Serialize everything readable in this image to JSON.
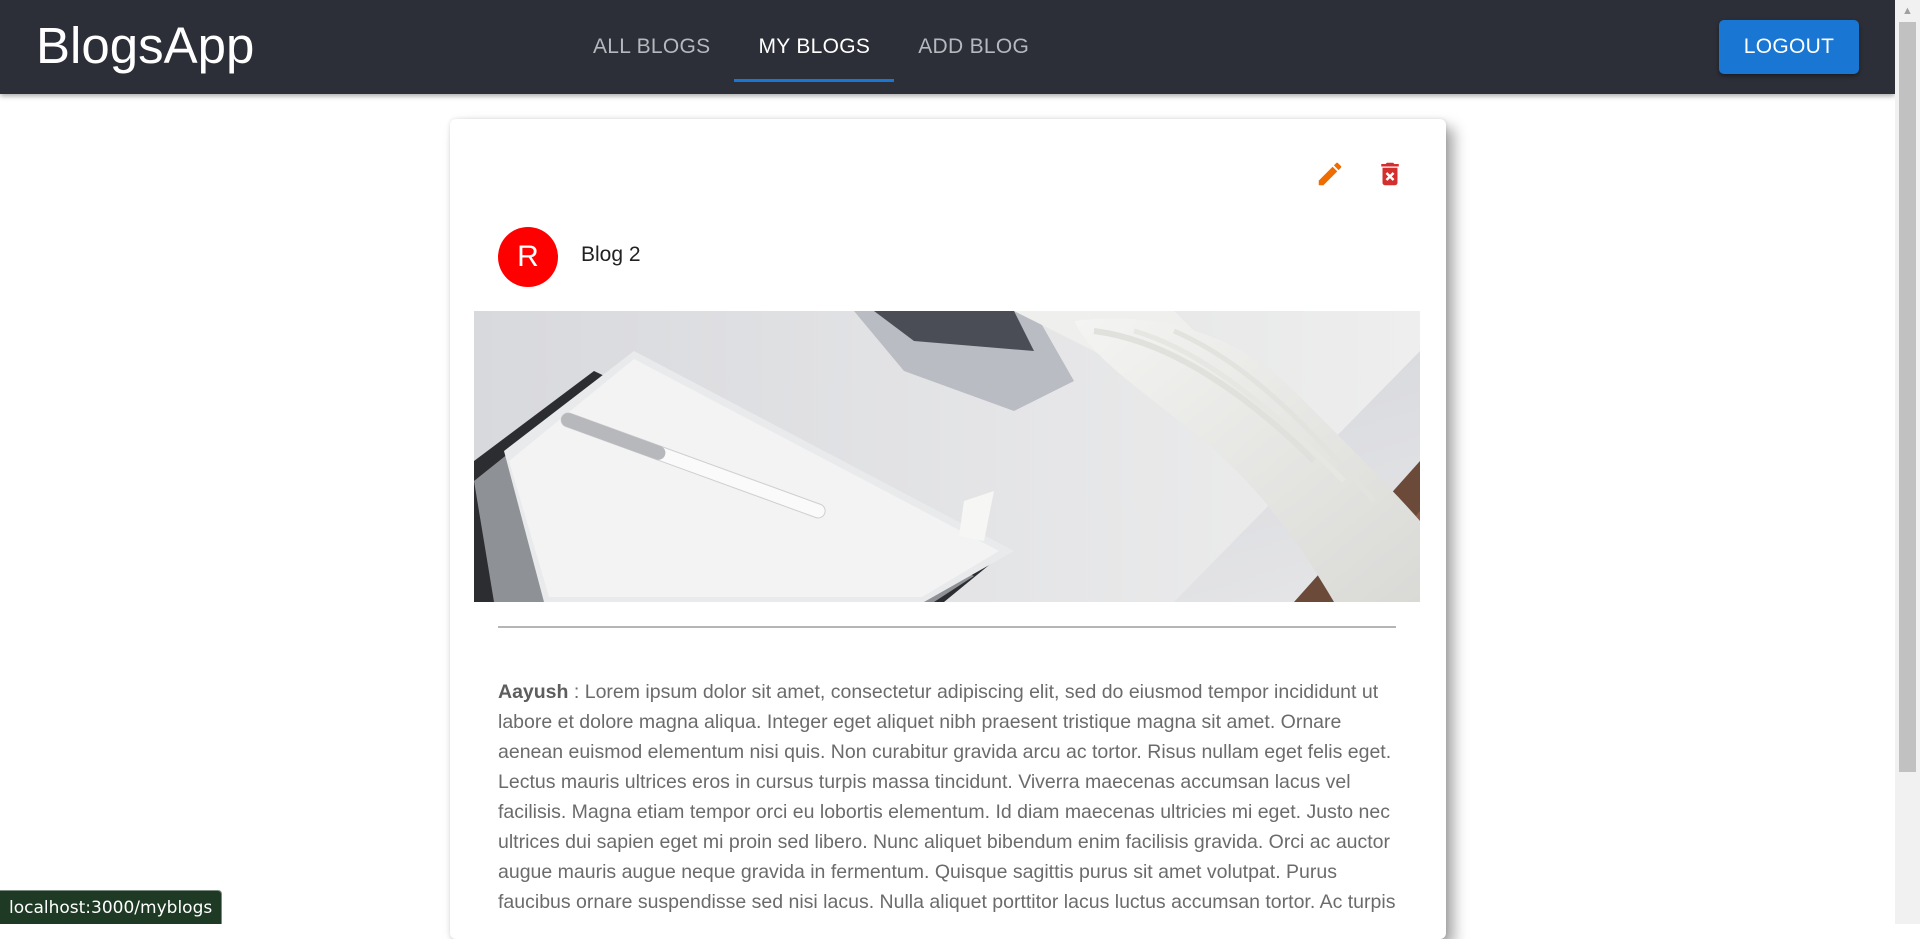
{
  "header": {
    "brand": "BlogsApp",
    "tabs": [
      {
        "label": "ALL BLOGS",
        "active": false
      },
      {
        "label": "MY BLOGS",
        "active": true
      },
      {
        "label": "ADD BLOG",
        "active": false
      }
    ],
    "logout_label": "LOGOUT"
  },
  "blog": {
    "avatar_letter": "R",
    "title": "Blog 2",
    "author": "Aayush",
    "separator": " : ",
    "description": "Lorem ipsum dolor sit amet, consectetur adipiscing elit, sed do eiusmod tempor incididunt ut labore et dolore magna aliqua. Integer eget aliquet nibh praesent tristique magna sit amet. Ornare aenean euismod elementum nisi quis. Non curabitur gravida arcu ac tortor. Risus nullam eget felis eget. Lectus mauris ultrices eros in cursus turpis massa tincidunt. Viverra maecenas accumsan lacus vel facilisis. Magna etiam tempor orci eu lobortis elementum. Id diam maecenas ultricies mi eget. Justo nec ultrices dui sapien eget mi proin sed libero. Nunc aliquet bibendum enim facilisis gravida. Orci ac auctor augue mauris augue neque gravida in fermentum. Quisque sagittis purus sit amet volutpat. Purus faucibus ornare suspendisse sed nisi lacus. Nulla aliquet porttitor lacus luctus accumsan tortor. Ac turpis",
    "edit_icon": "pencil-icon",
    "delete_icon": "trash-icon"
  },
  "status_bar": {
    "url": "localhost:3000/myblogs"
  },
  "colors": {
    "appbar": "#2d2f38",
    "accent": "#1976d2",
    "avatar": "#ff0000",
    "edit_icon": "#ef6c00",
    "delete_icon": "#d32f2f"
  }
}
